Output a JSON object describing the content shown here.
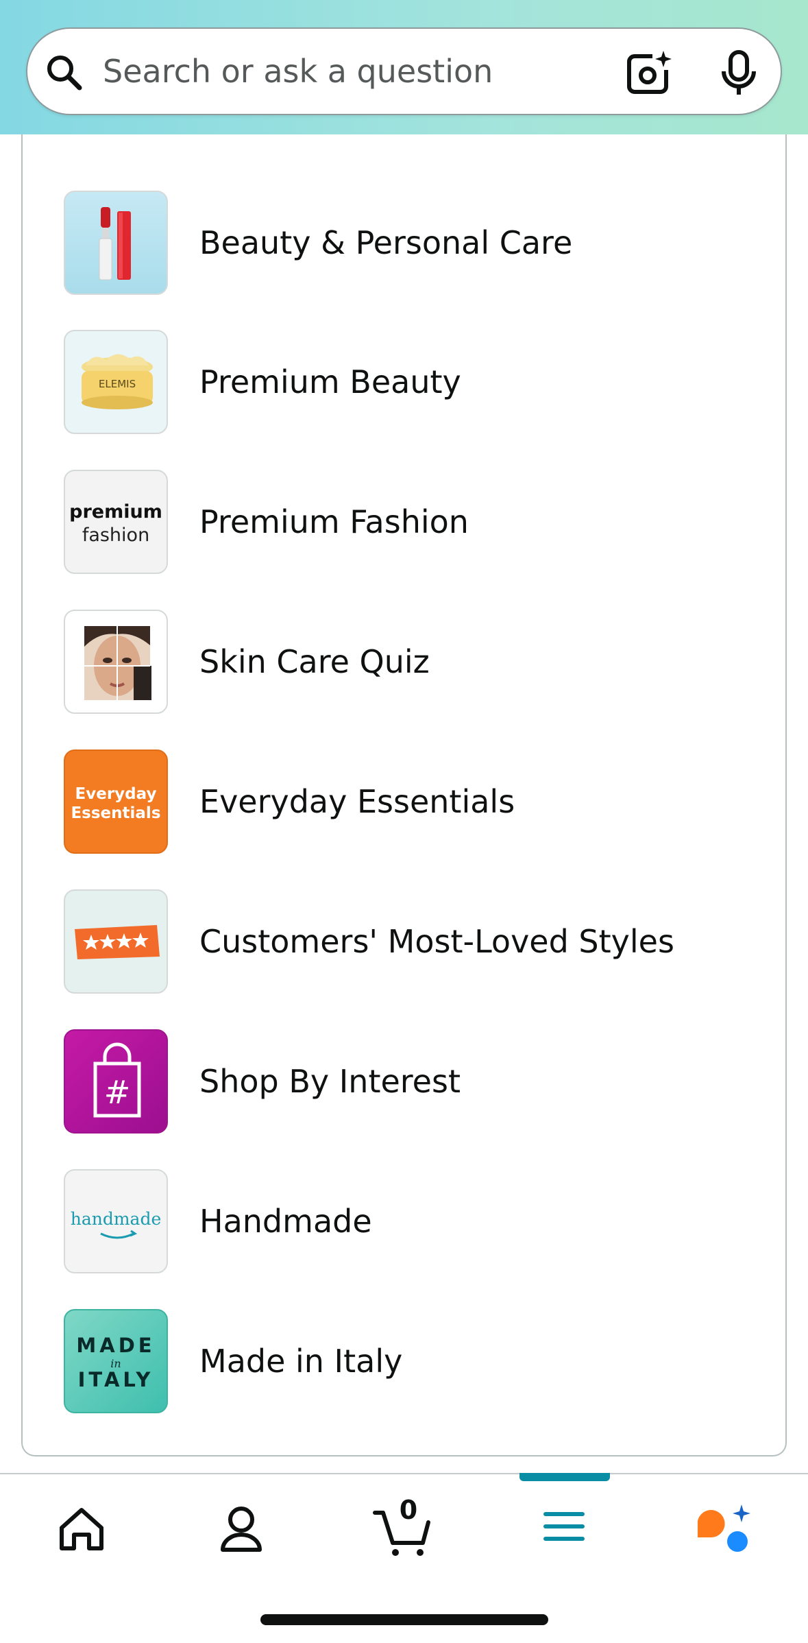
{
  "search": {
    "placeholder": "Search or ask a question",
    "icons": [
      "search-icon",
      "camera-sparkle-icon",
      "microphone-icon"
    ]
  },
  "categories": [
    {
      "label": "Beauty & Personal Care",
      "icon": "lipstick-thumbnail"
    },
    {
      "label": "Premium Beauty",
      "icon": "cream-jar-thumbnail",
      "thumb_text": "ELEMIS"
    },
    {
      "label": "Premium Fashion",
      "icon": "premium-fashion-thumbnail",
      "thumb_text": [
        "premium",
        "fashion"
      ]
    },
    {
      "label": "Skin Care Quiz",
      "icon": "face-collage-thumbnail"
    },
    {
      "label": "Everyday Essentials",
      "icon": "everyday-essentials-thumbnail",
      "thumb_text": [
        "Everyday",
        "Essentials"
      ]
    },
    {
      "label": "Customers' Most-Loved Styles",
      "icon": "stars-badge-thumbnail"
    },
    {
      "label": "Shop By Interest",
      "icon": "hashtag-bag-thumbnail",
      "thumb_text": "#"
    },
    {
      "label": "Handmade",
      "icon": "handmade-thumbnail",
      "thumb_text": "handmade"
    },
    {
      "label": "Made in Italy",
      "icon": "made-in-italy-thumbnail",
      "thumb_text": [
        "MADE",
        "in",
        "ITALY"
      ]
    }
  ],
  "bottom_nav": {
    "items": [
      "home-icon",
      "account-icon",
      "cart-icon",
      "menu-icon",
      "rufus-assistant-icon"
    ],
    "active": "menu-icon",
    "cart_count": "0"
  },
  "colors": {
    "accent": "#088da5",
    "header_gradient_start": "#84d8e3",
    "header_gradient_end": "#a6e7cd",
    "assistant_orange": "#ff7a1a",
    "assistant_blue": "#1a8cff"
  }
}
